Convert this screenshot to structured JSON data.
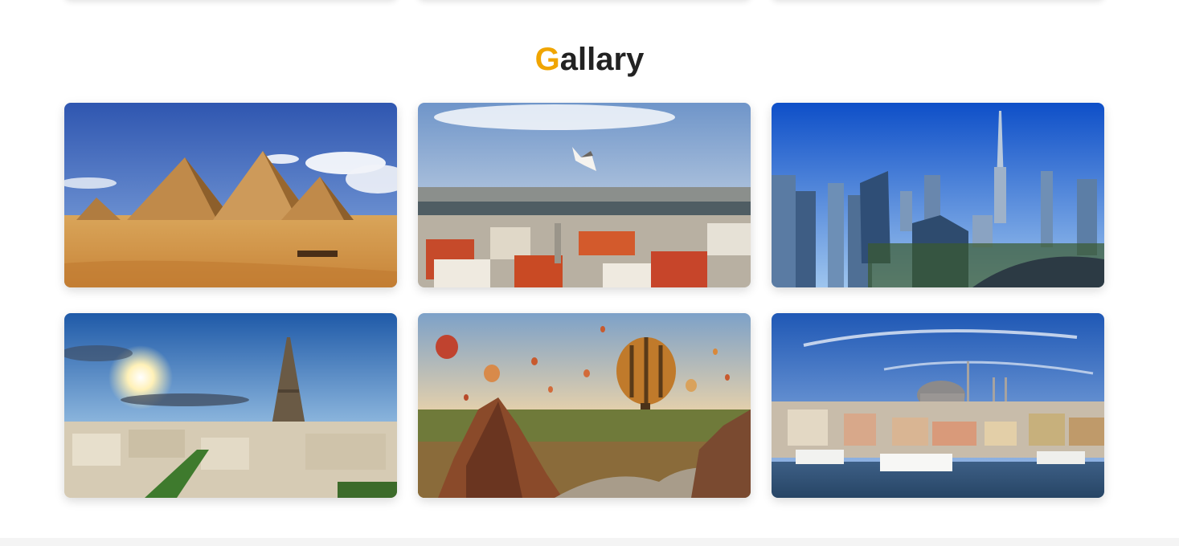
{
  "gallery": {
    "title_first_letter": "G",
    "title_rest": "allary",
    "images": [
      {
        "subject": "pyramids-giza"
      },
      {
        "subject": "istanbul-rooftops-seagull"
      },
      {
        "subject": "dubai-skyline"
      },
      {
        "subject": "paris-eiffel-tower"
      },
      {
        "subject": "cappadocia-balloons"
      },
      {
        "subject": "istanbul-mosque-bosphorus"
      }
    ]
  },
  "colors": {
    "accent": "#f0a500",
    "title": "#222222",
    "background": "#ffffff"
  }
}
